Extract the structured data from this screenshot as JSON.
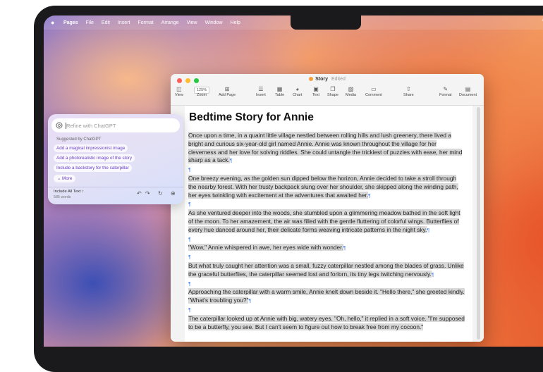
{
  "menubar": {
    "app_name": "Pages",
    "items": [
      "File",
      "Edit",
      "Insert",
      "Format",
      "Arrange",
      "View",
      "Window",
      "Help"
    ]
  },
  "window": {
    "title": "Story",
    "status": "Edited",
    "zoom": "125%",
    "toolbar": {
      "view": "View",
      "zoom": "Zoom",
      "add_page": "Add Page",
      "insert": "Insert",
      "table": "Table",
      "chart": "Chart",
      "text": "Text",
      "shape": "Shape",
      "media": "Media",
      "comment": "Comment",
      "share": "Share",
      "format": "Format",
      "document": "Document"
    }
  },
  "document": {
    "title": "Bedtime Story for Annie",
    "pilcrow": "¶",
    "paragraphs": [
      "Once upon a time, in a quaint little village nestled between rolling hills and lush greenery, there lived a bright and curious six-year-old girl named Annie. Annie was known throughout the village for her cleverness and her love for solving riddles. She could untangle the trickiest of puzzles with ease, her mind sharp as a tack.",
      "One breezy evening, as the golden sun dipped below the horizon, Annie decided to take a stroll through the nearby forest. With her trusty backpack slung over her shoulder, she skipped along the winding path, her eyes twinkling with excitement at the adventures that awaited her.",
      "As she ventured deeper into the woods, she stumbled upon a glimmering meadow bathed in the soft light of the moon. To her amazement, the air was filled with the gentle fluttering of colorful wings. Butterflies of every hue danced around her, their delicate forms weaving intricate patterns in the night sky.",
      "\"Wow,\" Annie whispered in awe, her eyes wide with wonder.",
      "But what truly caught her attention was a small, fuzzy caterpillar nestled among the blades of grass. Unlike the graceful butterflies, the caterpillar seemed lost and forlorn, its tiny legs twitching nervously.",
      "Approaching the caterpillar with a warm smile, Annie knelt down beside it. \"Hello there,\" she greeted kindly. \"What's troubling you?\"",
      "The caterpillar looked up at Annie with big, watery eyes. \"Oh, hello,\" it replied in a soft voice. \"I'm supposed to be a butterfly, you see. But I can't seem to figure out how to break free from my cocoon.\""
    ]
  },
  "writing_tools": {
    "placeholder": "Refine with ChatGPT",
    "suggested_label": "Suggested by ChatGPT",
    "suggestions": [
      "Add a magical impressionist image",
      "Add a photorealistic image of the story",
      "Include a backstory for the caterpillar"
    ],
    "more_label": "More",
    "include_label": "Include All Text",
    "word_count": "585 words"
  },
  "colors": {
    "accent_purple": "#6a3fc8",
    "selection_gray": "#d9d9d9",
    "traffic_red": "#fe5f57",
    "traffic_yellow": "#febc2e",
    "traffic_green": "#28c840"
  }
}
